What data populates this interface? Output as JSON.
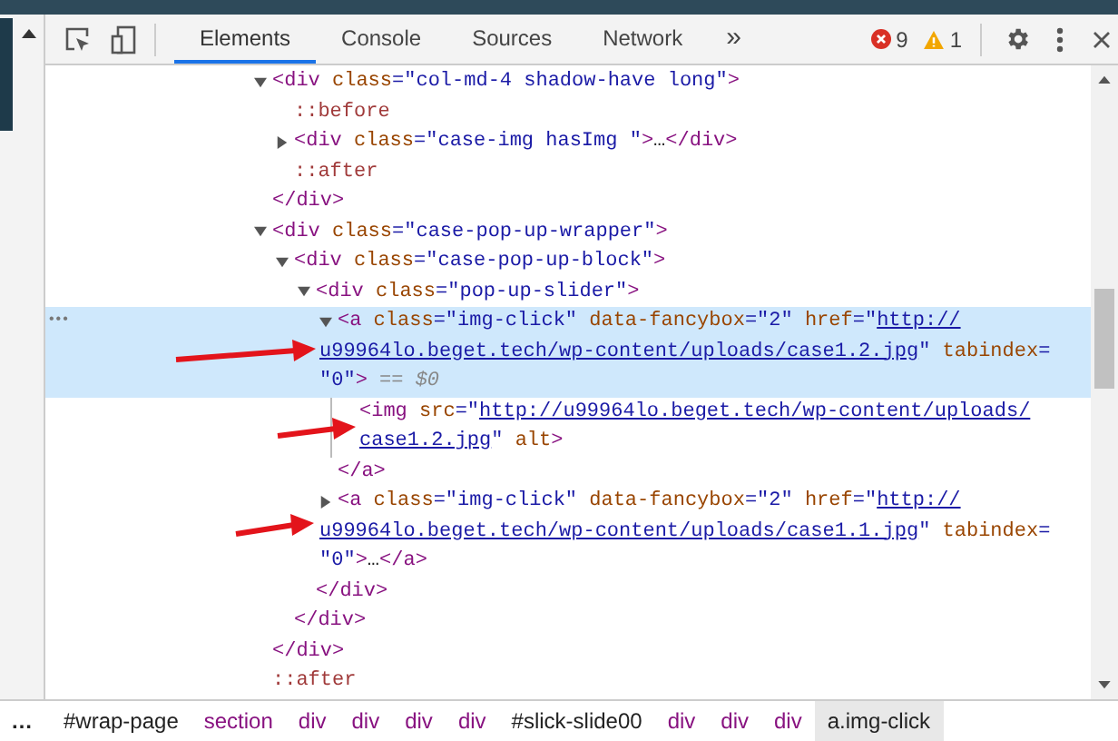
{
  "toolbar": {
    "tabs": [
      {
        "label": "Elements",
        "selected": true
      },
      {
        "label": "Console",
        "selected": false
      },
      {
        "label": "Sources",
        "selected": false
      },
      {
        "label": "Network",
        "selected": false
      }
    ],
    "more_tabs": "»",
    "errors": "9",
    "warnings": "1"
  },
  "tree": [
    {
      "kind": "element",
      "expanded": true,
      "selected": false,
      "lines": [
        [
          {
            "kind": "tag",
            "text": "<div"
          },
          {
            "kind": "attr",
            "text": " class"
          },
          {
            "kind": "value",
            "text": "=\"col-md-4 shadow-have long\""
          },
          {
            "kind": "tag",
            "text": ">"
          }
        ]
      ],
      "children": [
        {
          "kind": "pseudo",
          "text": "::before"
        },
        {
          "kind": "element",
          "expanded": false,
          "selected": false,
          "lines": [
            [
              {
                "kind": "tag",
                "text": "<div"
              },
              {
                "kind": "attr",
                "text": " class"
              },
              {
                "kind": "value",
                "text": "=\"case-img hasImg \""
              },
              {
                "kind": "tag",
                "text": ">"
              },
              {
                "kind": "text",
                "text": "…"
              },
              {
                "kind": "tag",
                "text": "</div>"
              }
            ]
          ]
        },
        {
          "kind": "pseudo",
          "text": "::after"
        }
      ],
      "close": [
        {
          "kind": "tag",
          "text": "</div>"
        }
      ]
    },
    {
      "kind": "element",
      "expanded": true,
      "selected": false,
      "lines": [
        [
          {
            "kind": "tag",
            "text": "<div"
          },
          {
            "kind": "attr",
            "text": " class"
          },
          {
            "kind": "value",
            "text": "=\"case-pop-up-wrapper\""
          },
          {
            "kind": "tag",
            "text": ">"
          }
        ]
      ],
      "children": [
        {
          "kind": "element",
          "expanded": true,
          "selected": false,
          "lines": [
            [
              {
                "kind": "tag",
                "text": "<div"
              },
              {
                "kind": "attr",
                "text": " class"
              },
              {
                "kind": "value",
                "text": "=\"case-pop-up-block\""
              },
              {
                "kind": "tag",
                "text": ">"
              }
            ]
          ],
          "children": [
            {
              "kind": "element",
              "expanded": true,
              "selected": false,
              "lines": [
                [
                  {
                    "kind": "tag",
                    "text": "<div"
                  },
                  {
                    "kind": "attr",
                    "text": " class"
                  },
                  {
                    "kind": "value",
                    "text": "=\"pop-up-slider\""
                  },
                  {
                    "kind": "tag",
                    "text": ">"
                  }
                ]
              ],
              "children": [
                {
                  "kind": "element",
                  "expanded": true,
                  "selected": true,
                  "actions": "•••",
                  "lines": [
                    [
                      {
                        "kind": "tag",
                        "text": "<a"
                      },
                      {
                        "kind": "attr",
                        "text": " class"
                      },
                      {
                        "kind": "value",
                        "text": "=\"img-click\""
                      },
                      {
                        "kind": "attr",
                        "text": " data-fancybox"
                      },
                      {
                        "kind": "value",
                        "text": "=\"2\""
                      },
                      {
                        "kind": "attr",
                        "text": " href"
                      },
                      {
                        "kind": "value",
                        "text": "=\""
                      },
                      {
                        "kind": "link",
                        "text": "http://"
                      }
                    ],
                    [
                      {
                        "kind": "link",
                        "text": "u99964lo.beget.tech/wp-content/uploads/case1.2.jpg"
                      },
                      {
                        "kind": "value",
                        "text": "\""
                      },
                      {
                        "kind": "attr",
                        "text": " tabindex"
                      },
                      {
                        "kind": "value",
                        "text": "="
                      }
                    ],
                    [
                      {
                        "kind": "value",
                        "text": "\"0\""
                      },
                      {
                        "kind": "tag",
                        "text": ">"
                      },
                      {
                        "kind": "hint",
                        "text": " == $0"
                      }
                    ]
                  ],
                  "children": [
                    {
                      "kind": "element",
                      "selected": false,
                      "lines": [
                        [
                          {
                            "kind": "tag",
                            "text": "<img"
                          },
                          {
                            "kind": "attr",
                            "text": " src"
                          },
                          {
                            "kind": "value",
                            "text": "=\""
                          },
                          {
                            "kind": "link",
                            "text": "http://u99964lo.beget.tech/wp-content/uploads/"
                          }
                        ],
                        [
                          {
                            "kind": "link",
                            "text": "case1.2.jpg"
                          },
                          {
                            "kind": "value",
                            "text": "\""
                          },
                          {
                            "kind": "attr",
                            "text": " alt"
                          },
                          {
                            "kind": "tag",
                            "text": ">"
                          }
                        ]
                      ]
                    }
                  ],
                  "close": [
                    {
                      "kind": "tag",
                      "text": "</a>"
                    }
                  ]
                },
                {
                  "kind": "element",
                  "expanded": false,
                  "selected": false,
                  "lines": [
                    [
                      {
                        "kind": "tag",
                        "text": "<a"
                      },
                      {
                        "kind": "attr",
                        "text": " class"
                      },
                      {
                        "kind": "value",
                        "text": "=\"img-click\""
                      },
                      {
                        "kind": "attr",
                        "text": " data-fancybox"
                      },
                      {
                        "kind": "value",
                        "text": "=\"2\""
                      },
                      {
                        "kind": "attr",
                        "text": " href"
                      },
                      {
                        "kind": "value",
                        "text": "=\""
                      },
                      {
                        "kind": "link",
                        "text": "http://"
                      }
                    ],
                    [
                      {
                        "kind": "link",
                        "text": "u99964lo.beget.tech/wp-content/uploads/case1.1.jpg"
                      },
                      {
                        "kind": "value",
                        "text": "\""
                      },
                      {
                        "kind": "attr",
                        "text": " tabindex"
                      },
                      {
                        "kind": "value",
                        "text": "="
                      }
                    ],
                    [
                      {
                        "kind": "value",
                        "text": "\"0\""
                      },
                      {
                        "kind": "tag",
                        "text": ">"
                      },
                      {
                        "kind": "text",
                        "text": "…"
                      },
                      {
                        "kind": "tag",
                        "text": "</a>"
                      }
                    ]
                  ]
                }
              ],
              "close": [
                {
                  "kind": "tag",
                  "text": "</div>"
                }
              ]
            }
          ],
          "close": [
            {
              "kind": "tag",
              "text": "</div>"
            }
          ]
        }
      ],
      "close": [
        {
          "kind": "tag",
          "text": "</div>"
        }
      ]
    },
    {
      "kind": "pseudo",
      "text": "::after"
    }
  ],
  "breadcrumbs": {
    "overflow": "…",
    "items": [
      {
        "text": "#wrap-page",
        "kind": "id",
        "selected": false
      },
      {
        "text": "section",
        "kind": "tag",
        "selected": false
      },
      {
        "text": "div",
        "kind": "tag",
        "selected": false
      },
      {
        "text": "div",
        "kind": "tag",
        "selected": false
      },
      {
        "text": "div",
        "kind": "tag",
        "selected": false
      },
      {
        "text": "div",
        "kind": "tag",
        "selected": false
      },
      {
        "text": "#slick-slide00",
        "kind": "id",
        "selected": false
      },
      {
        "text": "div",
        "kind": "tag",
        "selected": false
      },
      {
        "text": "div",
        "kind": "tag",
        "selected": false
      },
      {
        "text": "div",
        "kind": "tag",
        "selected": false
      },
      {
        "text": "a.img-click",
        "kind": "id",
        "selected": true
      }
    ]
  }
}
